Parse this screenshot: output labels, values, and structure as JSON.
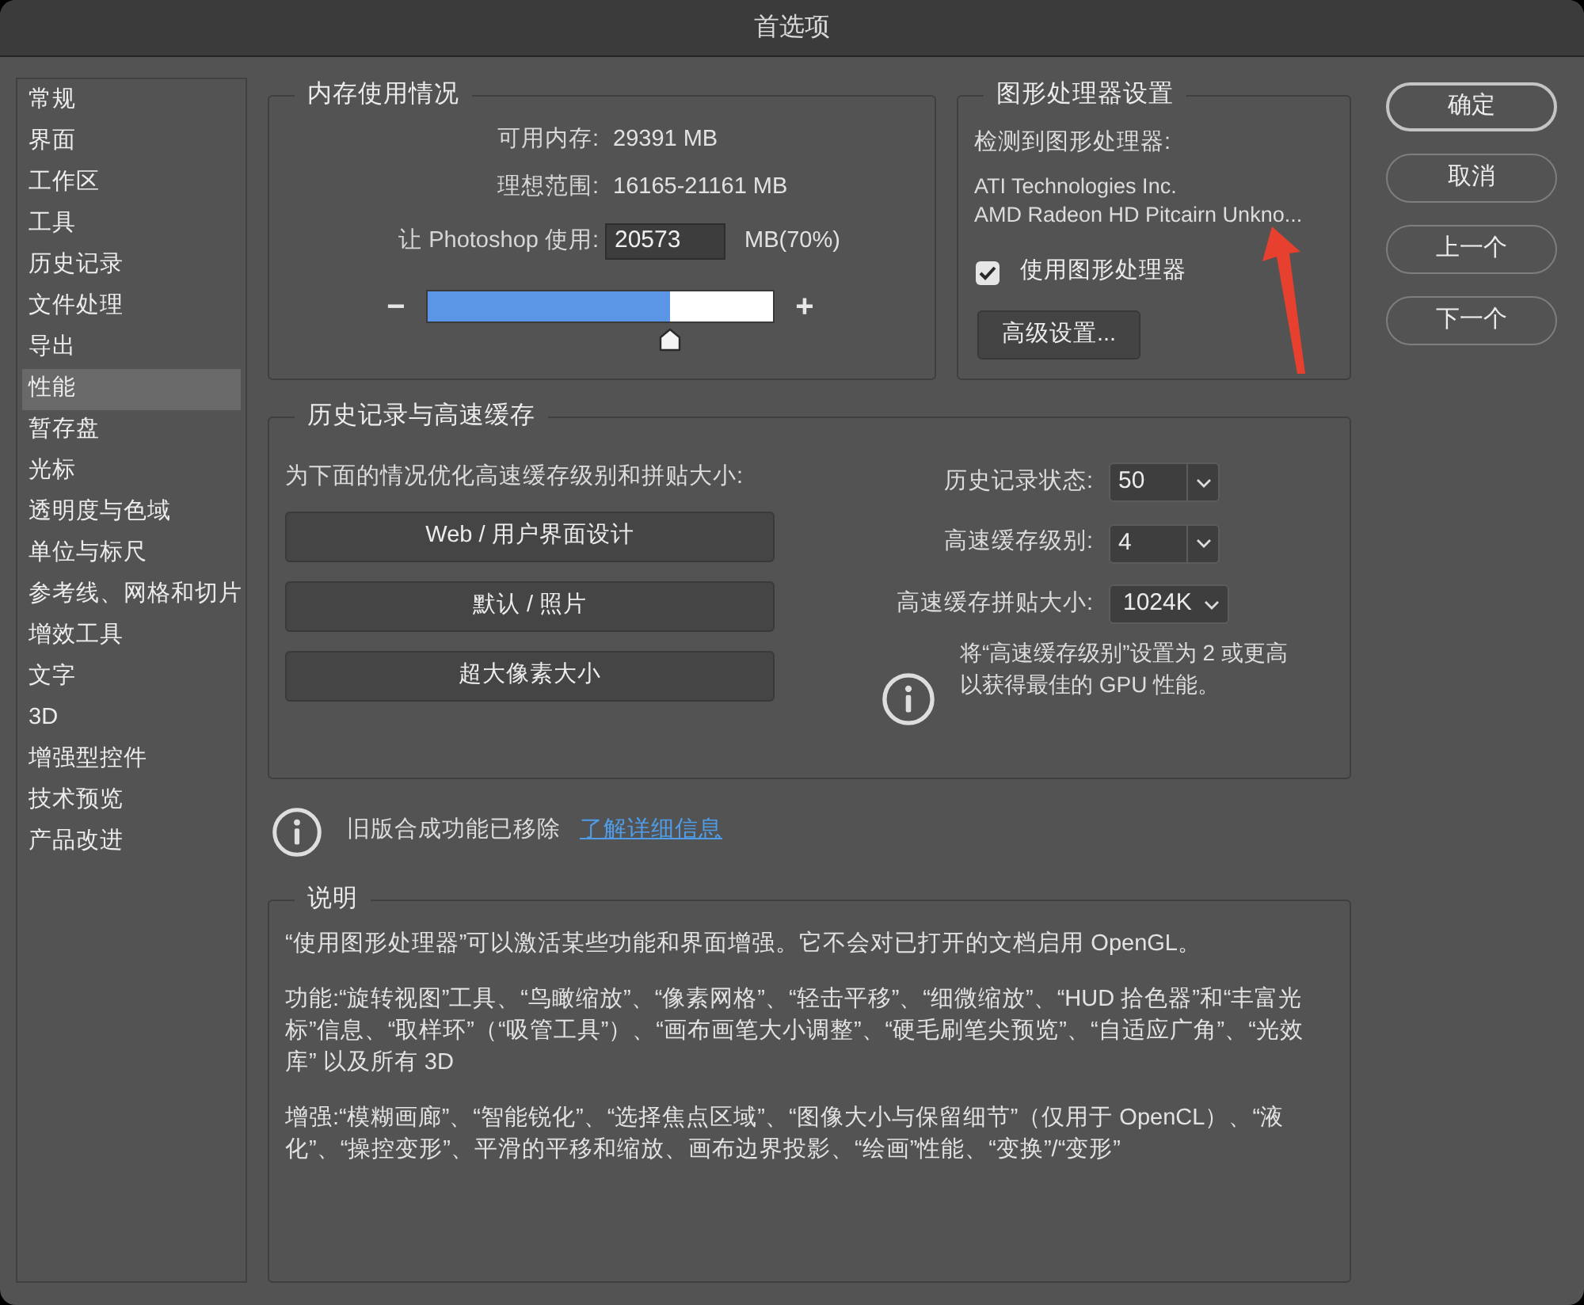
{
  "window": {
    "title": "首选项"
  },
  "sidebar": {
    "items": [
      {
        "label": "常规",
        "selected": false
      },
      {
        "label": "界面",
        "selected": false
      },
      {
        "label": "工作区",
        "selected": false
      },
      {
        "label": "工具",
        "selected": false
      },
      {
        "label": "历史记录",
        "selected": false
      },
      {
        "label": "文件处理",
        "selected": false
      },
      {
        "label": "导出",
        "selected": false
      },
      {
        "label": "性能",
        "selected": true
      },
      {
        "label": "暂存盘",
        "selected": false
      },
      {
        "label": "光标",
        "selected": false
      },
      {
        "label": "透明度与色域",
        "selected": false
      },
      {
        "label": "单位与标尺",
        "selected": false
      },
      {
        "label": "参考线、网格和切片",
        "selected": false
      },
      {
        "label": "增效工具",
        "selected": false
      },
      {
        "label": "文字",
        "selected": false
      },
      {
        "label": "3D",
        "selected": false
      },
      {
        "label": "增强型控件",
        "selected": false
      },
      {
        "label": "技术预览",
        "selected": false
      },
      {
        "label": "产品改进",
        "selected": false
      }
    ]
  },
  "memory": {
    "title": "内存使用情况",
    "rows": [
      {
        "label": "可用内存:",
        "value": "29391 MB"
      },
      {
        "label": "理想范围:",
        "value": "16165-21161 MB"
      }
    ],
    "usage": {
      "label": "让 Photoshop 使用:",
      "value": "20573",
      "unit": "MB(70%)"
    },
    "slider": {
      "decrease": "−",
      "increase": "+",
      "level": 0.7
    }
  },
  "gpu": {
    "title": "图形处理器设置",
    "detected_label": "检测到图形处理器:",
    "vendor": "ATI Technologies Inc.",
    "model": "AMD Radeon HD Pitcairn Unkno...",
    "use_gpu": {
      "label": "使用图形处理器",
      "checked": true
    },
    "advanced_button": "高级设置..."
  },
  "dialog_buttons": [
    {
      "label": "确定",
      "default": true
    },
    {
      "label": "取消",
      "default": false
    },
    {
      "label": "上一个",
      "default": false
    },
    {
      "label": "下一个",
      "default": false
    }
  ],
  "history_cache": {
    "title": "历史记录与高速缓存",
    "optimize_label": "为下面的情况优化高速缓存级别和拼贴大小:",
    "presets": [
      "Web / 用户界面设计",
      "默认 / 照片",
      "超大像素大小"
    ],
    "settings": [
      {
        "kind": "combo",
        "label": "历史记录状态:",
        "value": "50"
      },
      {
        "kind": "combo",
        "label": "高速缓存级别:",
        "value": "4"
      },
      {
        "kind": "popup",
        "label": "高速缓存拼贴大小:",
        "value": "1024K"
      }
    ],
    "tip": "将“高速缓存级别”设置为 2 或更高以获得最佳的 GPU 性能。"
  },
  "notice": {
    "text": "旧版合成功能已移除",
    "link": "了解详细信息"
  },
  "description": {
    "title": "说明",
    "paragraphs": [
      "“使用图形处理器”可以激活某些功能和界面增强。它不会对已打开的文档启用 OpenGL。",
      "功能:“旋转视图”工具、“鸟瞰缩放”、“像素网格”、“轻击平移”、“细微缩放”、“HUD 拾色器”和“丰富光标”信息、“取样环”（“吸管工具”）、“画布画笔大小调整”、“硬毛刷笔尖预览”、“自适应广角”、“光效库” 以及所有 3D",
      "增强:“模糊画廊”、“智能锐化”、“选择焦点区域”、“图像大小与保留细节”（仅用于 OpenCL）、“液化”、“操控变形”、平滑的平移和缩放、画布边界投影、“绘画”性能、“变换”/“变形”"
    ]
  }
}
